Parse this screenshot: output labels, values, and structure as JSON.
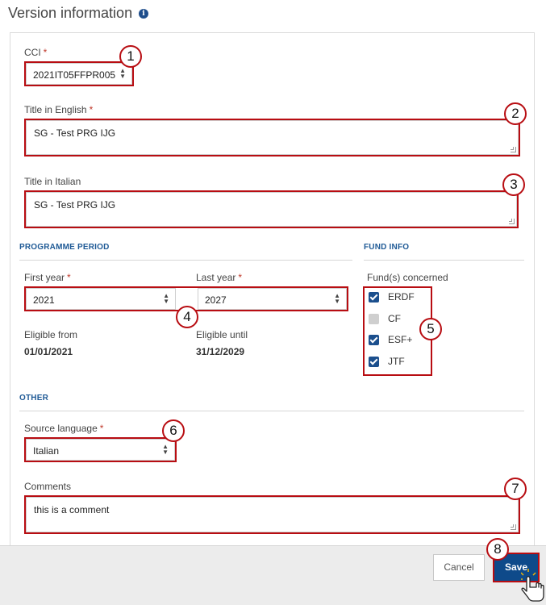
{
  "header": {
    "title": "Version information",
    "info_icon": "info-icon"
  },
  "cci": {
    "label": "CCI",
    "required": "*",
    "value": "2021IT05FFPR005"
  },
  "title_en": {
    "label": "Title in English",
    "required": "*",
    "value": "SG - Test PRG IJG"
  },
  "title_it": {
    "label": "Title in Italian",
    "value": "SG - Test PRG IJG"
  },
  "programme_period": {
    "heading": "PROGRAMME PERIOD",
    "first_year": {
      "label": "First year",
      "required": "*",
      "value": "2021"
    },
    "last_year": {
      "label": "Last year",
      "required": "*",
      "value": "2027"
    },
    "eligible_from": {
      "label": "Eligible from",
      "value": "01/01/2021"
    },
    "eligible_until": {
      "label": "Eligible until",
      "value": "31/12/2029"
    }
  },
  "fund_info": {
    "heading": "FUND INFO",
    "label": "Fund(s) concerned",
    "funds": [
      {
        "name": "ERDF",
        "checked": true
      },
      {
        "name": "CF",
        "checked": false
      },
      {
        "name": "ESF+",
        "checked": true
      },
      {
        "name": "JTF",
        "checked": true
      }
    ]
  },
  "other": {
    "heading": "OTHER",
    "source_language": {
      "label": "Source language",
      "required": "*",
      "value": "Italian"
    },
    "comments": {
      "label": "Comments",
      "value": "this is a comment"
    }
  },
  "badges": [
    "1",
    "2",
    "3",
    "4",
    "5",
    "6",
    "7",
    "8"
  ],
  "footer": {
    "cancel_label": "Cancel",
    "save_label": "Save"
  },
  "colors": {
    "highlight": "#b80d12",
    "primary": "#0e4a8a",
    "section": "#1f5a96"
  }
}
